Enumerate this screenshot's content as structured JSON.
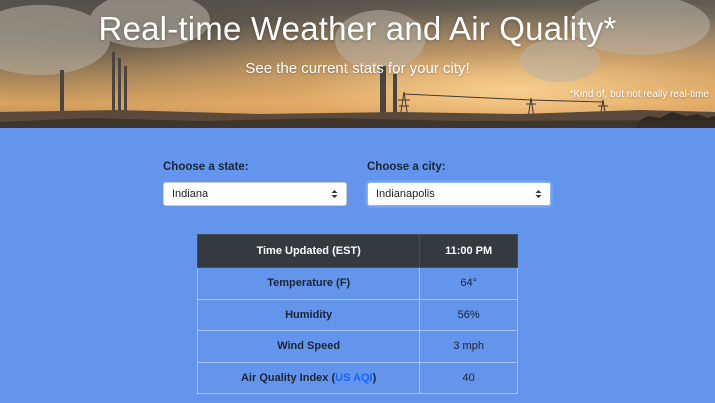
{
  "hero": {
    "title": "Real-time Weather and Air Quality*",
    "subtitle": "See the current stats for your city!",
    "footnote": "*Kind of, but not really real-time"
  },
  "form": {
    "state": {
      "label": "Choose a state:",
      "value": "Indiana"
    },
    "city": {
      "label": "Choose a city:",
      "value": "Indianapolis"
    }
  },
  "table": {
    "header": {
      "label": "Time Updated (EST)",
      "value": "11:00 PM"
    },
    "rows": [
      {
        "label": "Temperature (F)",
        "value": "64°"
      },
      {
        "label": "Humidity",
        "value": "56%"
      },
      {
        "label": "Wind Speed",
        "value": "3 mph"
      }
    ],
    "aqi": {
      "label_prefix": "Air Quality Index (",
      "link_text": "US AQI",
      "label_suffix": ")",
      "value": "40"
    }
  },
  "colors": {
    "page_background": "#6495ed",
    "table_header": "#343a40",
    "link": "#1565ff"
  }
}
